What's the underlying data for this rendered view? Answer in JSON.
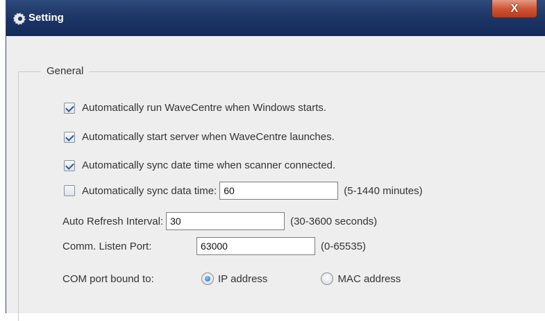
{
  "window": {
    "title": "Setting",
    "close_label": "X"
  },
  "general": {
    "legend": "General",
    "options": [
      {
        "label": "Automatically run WaveCentre when Windows starts.",
        "checked": true
      },
      {
        "label": "Automatically start server when WaveCentre launches.",
        "checked": true
      },
      {
        "label": "Automatically sync date time when scanner connected.",
        "checked": true
      }
    ],
    "sync": {
      "label": "Automatically sync data time:",
      "checked": false,
      "value": "60",
      "unit": "(5-1440 minutes)"
    },
    "refresh": {
      "label": "Auto Refresh Interval:",
      "value": "30",
      "unit": "(30-3600 seconds)"
    },
    "port": {
      "label": "Comm. Listen Port:",
      "value": "63000",
      "unit": "(0-65535)"
    },
    "com": {
      "label": "COM port bound to:",
      "options": [
        {
          "label": "IP address",
          "selected": true
        },
        {
          "label": "MAC address",
          "selected": false
        }
      ]
    }
  },
  "colors": {
    "titlebar": "#1d3766",
    "close_button": "#cf5636",
    "panel": "#eeeeef"
  }
}
